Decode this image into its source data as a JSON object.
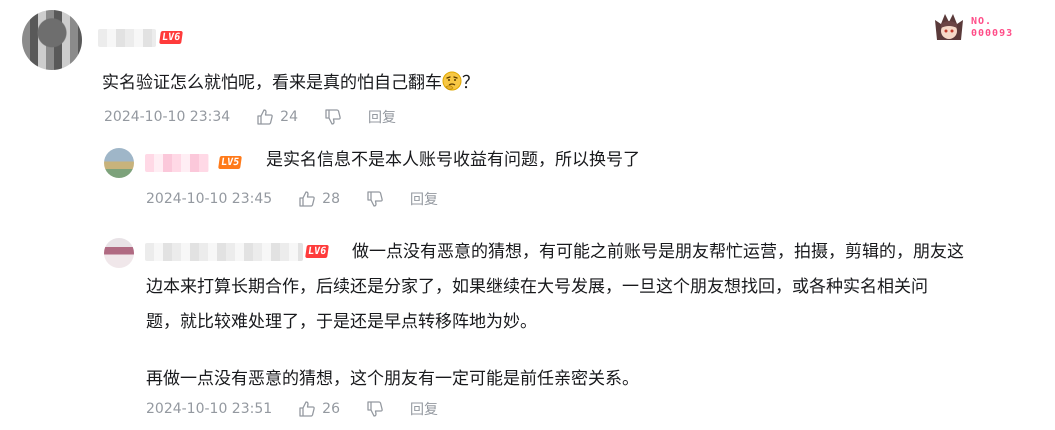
{
  "comment": {
    "user": {
      "level": "LV6"
    },
    "text": "实名验证怎么就怕呢，看来是真的怕自己翻车",
    "text_after_emoji": "？",
    "time": "2024-10-10 23:34",
    "likes": "24",
    "reply_label": "回复"
  },
  "badge": {
    "line1": "NO.",
    "line2": "000093"
  },
  "replies": [
    {
      "level": "LV5",
      "text": "是实名信息不是本人账号收益有问题，所以换号了",
      "time": "2024-10-10 23:45",
      "likes": "28",
      "reply_label": "回复"
    },
    {
      "level": "LV6",
      "text_line1": "做一点没有恶意的猜想，有可能之前账号是朋友帮忙运营，拍摄，剪辑的，朋友这",
      "text_line2": "边本来打算长期合作，后续还是分家了，如果继续在大号发展，一旦这个朋友想找回，或各种实名相关问",
      "text_line3": "题，就比较难处理了，于是还是早点转移阵地为妙。",
      "text_line4": "再做一点没有恶意的猜想，这个朋友有一定可能是前任亲密关系。",
      "time": "2024-10-10 23:51",
      "likes": "26",
      "reply_label": "回复"
    }
  ],
  "colors": {
    "meta_gray": "#9499a0",
    "lv6": "#ff3b3b",
    "lv5": "#ff7a1a",
    "badge_pink": "#ff4d88"
  },
  "icons": [
    "thumb-up-icon",
    "thumb-down-icon",
    "thinking-emoji-icon"
  ]
}
